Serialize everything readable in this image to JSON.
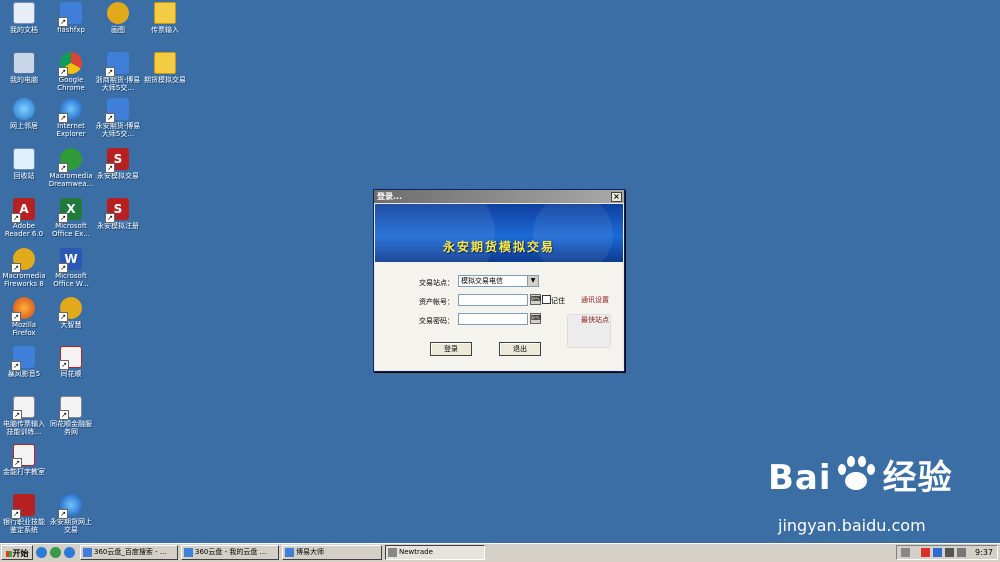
{
  "desktop": {
    "icons": [
      {
        "label": "我的文档",
        "icon": "my-documents-icon"
      },
      {
        "label": "flashfxp",
        "icon": "flashfxp-icon"
      },
      {
        "label": "画图",
        "icon": "paint-icon"
      },
      {
        "label": "传票输入",
        "icon": "folder-icon"
      },
      {
        "label": "我的电脑",
        "icon": "my-computer-icon"
      },
      {
        "label": "Google Chrome",
        "icon": "chrome-icon"
      },
      {
        "label": "浙商期货-博易大师5交...",
        "icon": "boyi-icon"
      },
      {
        "label": "期货模拟交易",
        "icon": "folder-icon"
      },
      {
        "label": "网上邻居",
        "icon": "network-icon"
      },
      {
        "label": "Internet Explorer",
        "icon": "ie-icon"
      },
      {
        "label": "永安期货-博易大师5交...",
        "icon": "boyi-icon"
      },
      {
        "label": "回收站",
        "icon": "recycle-bin-icon"
      },
      {
        "label": "Macromedia Dreamwea...",
        "icon": "dreamweaver-icon"
      },
      {
        "label": "永安模拟交易",
        "icon": "yongan-trade-icon"
      },
      {
        "label": "Adobe Reader 6.0",
        "icon": "adobe-reader-icon"
      },
      {
        "label": "Microsoft Office Ex...",
        "icon": "excel-icon"
      },
      {
        "label": "永安模拟注册",
        "icon": "yongan-register-icon"
      },
      {
        "label": "Macromedia Fireworks 8",
        "icon": "fireworks-icon"
      },
      {
        "label": "Microsoft Office W...",
        "icon": "word-icon"
      },
      {
        "label": "Mozilla Firefox",
        "icon": "firefox-icon"
      },
      {
        "label": "大智慧",
        "icon": "dazhihui-icon"
      },
      {
        "label": "暴风影音5",
        "icon": "baofeng-icon"
      },
      {
        "label": "同花顺",
        "icon": "tonghuashun-icon"
      },
      {
        "label": "电脑传票输入技能训练...",
        "icon": "typing-training-icon"
      },
      {
        "label": "同花顺金融服务网",
        "icon": "news-icon"
      },
      {
        "label": "金能打字教室",
        "icon": "typing-class-icon"
      },
      {
        "label": "银行职业技能鉴定系统",
        "icon": "bank-skill-icon"
      },
      {
        "label": "永安期货网上交易",
        "icon": "online-trade-icon"
      }
    ]
  },
  "login": {
    "title": "登录...",
    "close": "×",
    "banner": "永安期货模拟交易",
    "site_label": "交易站点：",
    "site_value": "模拟交易电信",
    "account_label": "资产帐号：",
    "account_value": "",
    "remember_label": "记住",
    "password_label": "交易密码：",
    "password_value": "",
    "comm_settings": "通讯设置",
    "fastest_site": "最快站点",
    "login_button": "登录",
    "exit_button": "退出"
  },
  "watermark": {
    "brand": "Bai",
    "brand2": "经验",
    "url": "jingyan.baidu.com"
  },
  "taskbar": {
    "start": "开始",
    "buttons": [
      {
        "label": "360云盘_百度搜索 - ..."
      },
      {
        "label": "360云盘 - 我的云盘 ..."
      },
      {
        "label": "博易大师"
      },
      {
        "label": "Newtrade"
      }
    ],
    "clock": "9:37"
  },
  "colors": {
    "desktop_bg": "#3a6ea5",
    "banner_text": "#ffe83a",
    "link": "#8b1a1a"
  }
}
